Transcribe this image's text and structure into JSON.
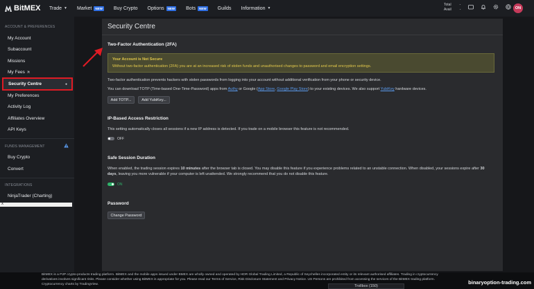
{
  "brand": {
    "name": "BitMEX",
    "accent": "#2f6fe4",
    "alert": "#e01b24"
  },
  "topnav": {
    "items": [
      {
        "label": "Trade",
        "has_caret": true,
        "badge": ""
      },
      {
        "label": "Market",
        "has_caret": false,
        "badge": "NEW"
      },
      {
        "label": "Buy Crypto",
        "has_caret": false,
        "badge": ""
      },
      {
        "label": "Options",
        "has_caret": false,
        "badge": "NEW"
      },
      {
        "label": "Bots",
        "has_caret": false,
        "badge": "NEW"
      },
      {
        "label": "Guilds",
        "has_caret": false,
        "badge": ""
      },
      {
        "label": "Information",
        "has_caret": true,
        "badge": ""
      }
    ],
    "balance": {
      "total_label": "Total",
      "total_value": "-",
      "avail_label": "Avail",
      "avail_value": "-"
    },
    "icons": [
      "wallet-icon",
      "bell-icon",
      "gear-icon",
      "language-icon"
    ],
    "avatar_initials": "ON"
  },
  "sidebar": {
    "section_account": "ACCOUNT & PREFERENCES",
    "account_items": [
      "My Account",
      "Subaccount",
      "Missions",
      "My Fees"
    ],
    "active_item": "Security Centre",
    "more_items": [
      "My Preferences",
      "Activity Log",
      "Affiliates Overview",
      "API Keys"
    ],
    "section_funds": "FUNDS MANAGEMENT",
    "funds_items": [
      "Buy Crypto",
      "Convert"
    ],
    "section_integrations": "INTEGRATIONS",
    "integration_items": [
      "NinjaTrader (Charting)"
    ],
    "scroll_close": "x"
  },
  "main": {
    "page_title": "Security Centre",
    "two_fa": {
      "heading": "Two-Factor Authentication (2FA)",
      "warning_title": "Your Account is Not Secure",
      "warning_text": "Without two-factor authentication (2FA) you are at an increased risk of stolen funds and unauthorised changes to password and email encryption settings.",
      "desc": "Two-factor authentication prevents hackers with stolen passwords from logging into your account without additional verification from your phone or security device.",
      "download_pre": "You can download TOTP (Time-based One-Time-Password) apps from ",
      "link_authy": "Authy",
      "download_mid1": " or Google (",
      "link_appstore": "App Store",
      "download_mid2": ", ",
      "link_playstore": "Google Play Store",
      "download_mid3": ") to your existing devices. We also support ",
      "link_yubikey": "YubiKey",
      "download_post": " hardware devices.",
      "btn_totp": "Add TOTP...",
      "btn_yubikey": "Add YubiKey..."
    },
    "ip": {
      "heading": "IP-Based Access Restriction",
      "desc": "This setting automatically closes all sessions if a new IP address is detected. If you trade on a mobile browser this feature is not recommended.",
      "toggle_label": "OFF"
    },
    "session": {
      "heading": "Safe Session Duration",
      "line1_pre": "When enabled, the trading session expires ",
      "line1_bold1": "10 minutes",
      "line1_mid": " after the browser tab is closed. You may disable this feature if you experience problems related to an unstable connection. When disabled, your sessions expire after ",
      "line1_bold2": "30",
      "line2_bold": "days",
      "line2_rest": ", leaving you more vulnerable if your computer is left unattended. We strongly recommend that you do not disable this feature.",
      "toggle_label": "ON"
    },
    "password": {
      "heading": "Password",
      "btn": "Change Password"
    }
  },
  "footer": {
    "line1": "BitMEX is a P2P crypto-products trading platform. BitMEX and the mobile apps issued under BMEX are wholly owned and operated by HDR Global Trading Limited, a Republic of Seychelles incorporated entity or its relevant authorised affiliates. Trading in cryptocurrency",
    "line2": "derivatives involves significant risks. Please consider whether using BitMEX is appropriate for you. Please read our Terms of Service, Risk Disclosure Statement and Privacy Notice. US Persons are prohibited from accessing the services of the BitMEX trading platform.",
    "line3": "Cryptocurrency charts by TradingView.",
    "trollbox": "Trollbox (150)",
    "watermark": "binaryoption-trading.com"
  }
}
